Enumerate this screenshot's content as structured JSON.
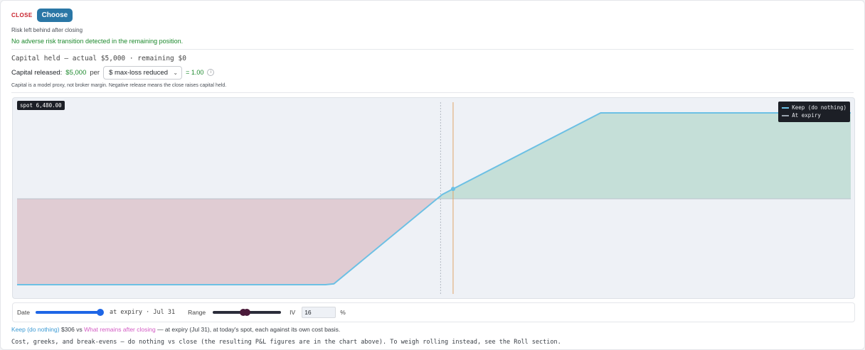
{
  "header": {
    "close_tag": "CLOSE",
    "choose_label": "Choose",
    "risk_label": "Risk left behind after closing",
    "risk_status": "No adverse risk transition detected in the remaining position."
  },
  "capital": {
    "held_line": "Capital held — actual $5,000 · remaining $0",
    "released_label": "Capital released:",
    "released_value": "$5,000",
    "per_label": "per",
    "basis_select": "$ max-loss reduced",
    "ratio": "= 1.00",
    "info_glyph": "i",
    "note": "Capital is a model proxy, not broker margin. Negative release means the close raises capital held."
  },
  "chart": {
    "spot_badge": "spot 6,480.00",
    "legend": [
      {
        "label": "Keep (do nothing)",
        "style": "solid"
      },
      {
        "label": "At expiry",
        "style": "dashed"
      }
    ],
    "colors": {
      "line": "#6cc0e4",
      "profit_fill": "#c5dfd8",
      "loss_fill": "#e0ccd3",
      "spot_line": "#e0a46a"
    }
  },
  "chart_data": {
    "type": "area",
    "title": "",
    "xlabel": "",
    "ylabel": "",
    "x": [
      0,
      0.37,
      0.38,
      0.5,
      0.51,
      0.52,
      0.7,
      1.0
    ],
    "series": [
      {
        "name": "Keep (do nothing)",
        "values": [
          -1,
          -1,
          -0.99,
          -0.03,
          0.05,
          0.1,
          1,
          1
        ]
      }
    ],
    "ylim": [
      -1,
      1
    ],
    "grid": false,
    "legend_position": "top-right"
  },
  "controls": {
    "date_label": "Date",
    "date_value": 1.0,
    "expiry_text": "at expiry · Jul 31",
    "range_label": "Range",
    "range_low": 0.43,
    "range_high": 0.48,
    "iv_label": "IV",
    "iv_value": "16",
    "pct_label": "%"
  },
  "comparison": {
    "keep_label": "Keep (do nothing)",
    "keep_value": " $306 vs ",
    "remains_label": "What remains after closing",
    "suffix": " — at expiry (Jul 31), at today's spot, each against its own cost basis."
  },
  "footer": {
    "note": "Cost, greeks, and break-evens — do nothing vs close (the resulting P&L figures are in the chart above). To weigh rolling instead, see the Roll section."
  }
}
